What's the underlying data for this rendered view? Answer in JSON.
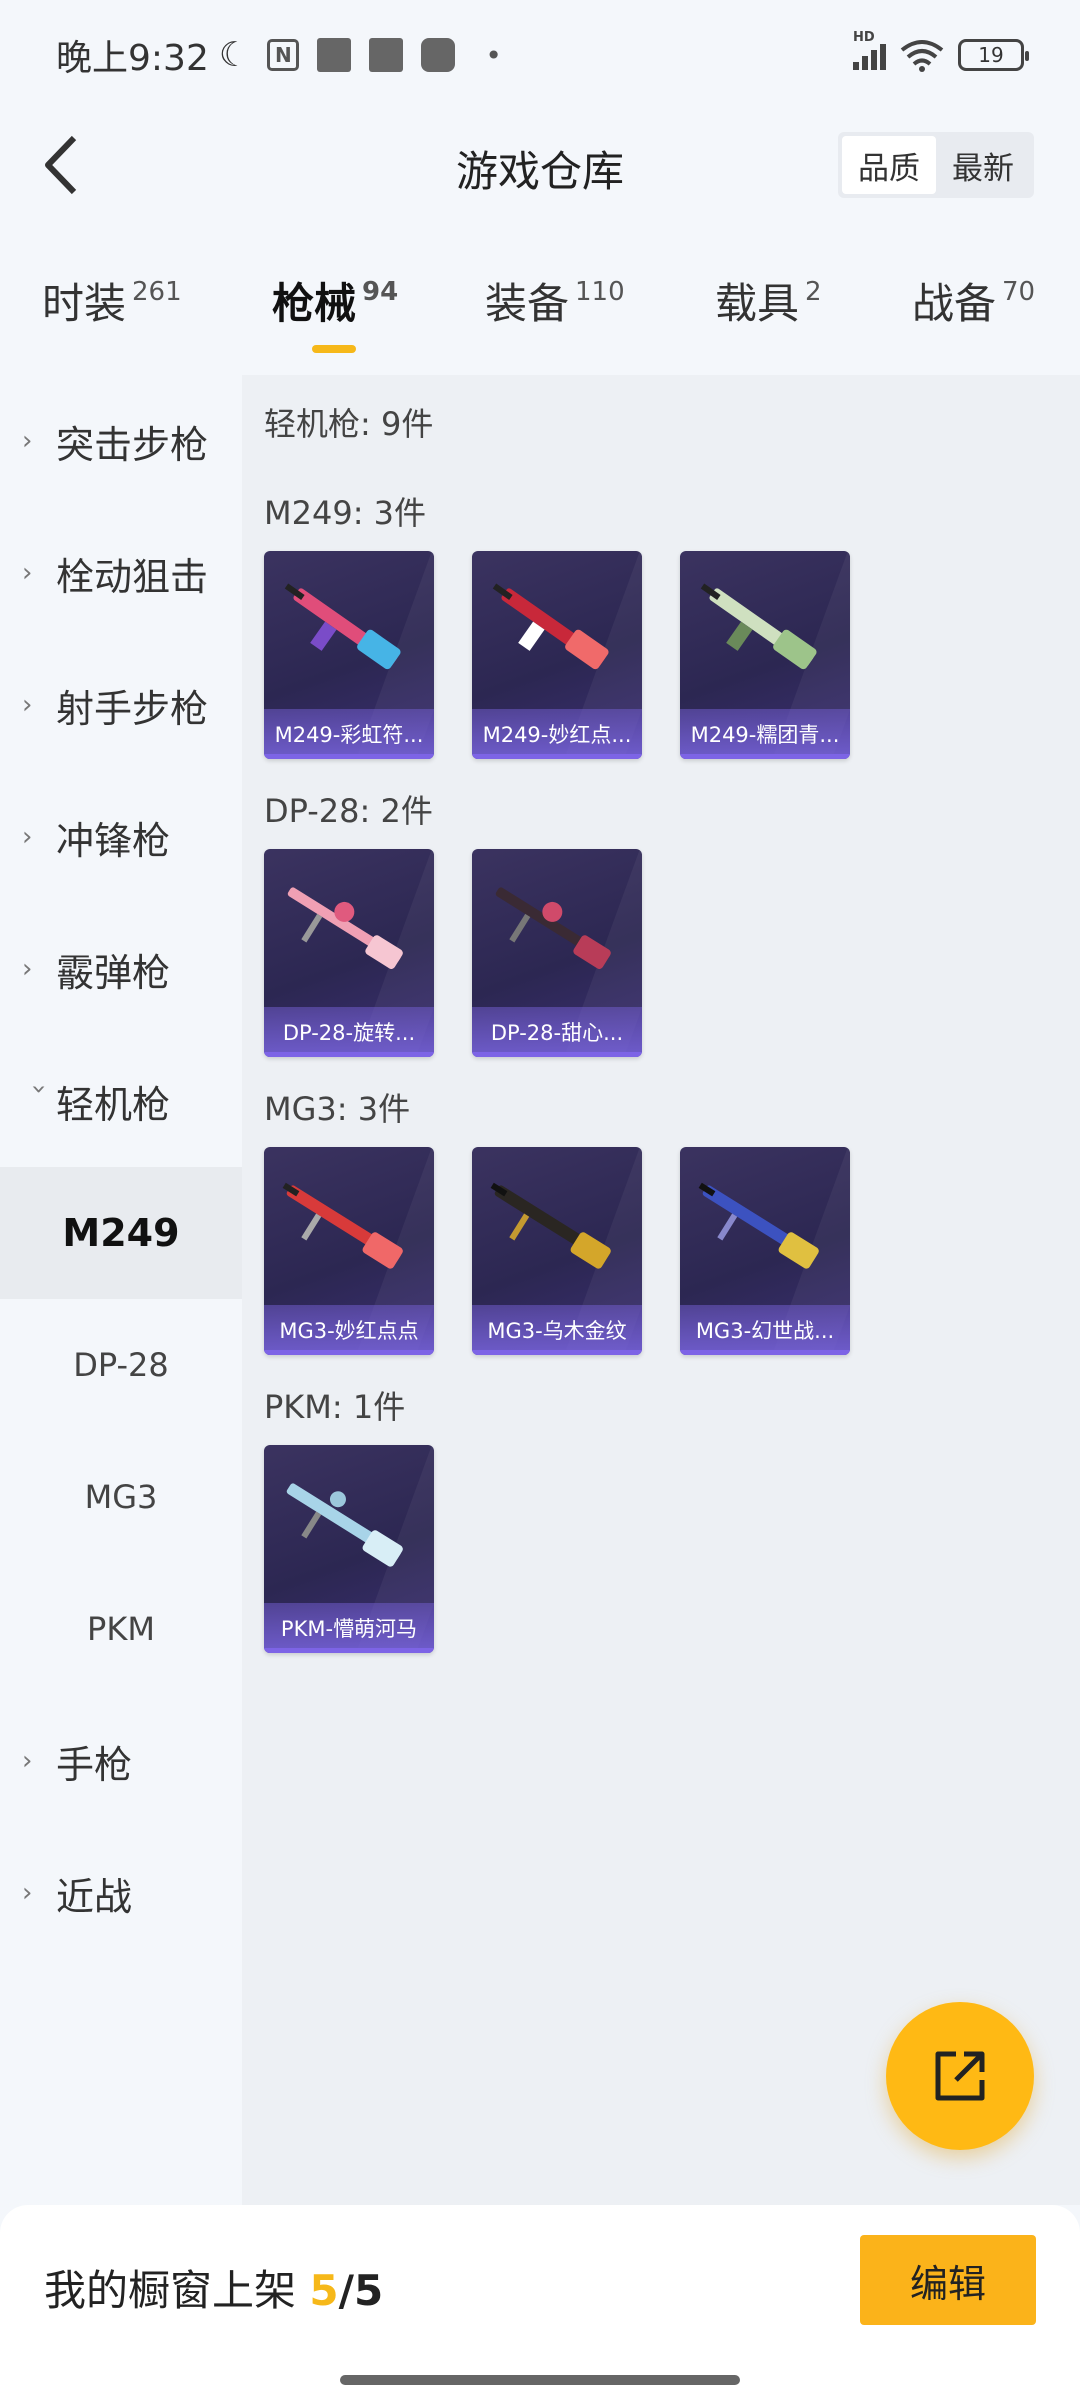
{
  "status_bar": {
    "time": "晚上9:32",
    "nfc": "N",
    "battery": "19",
    "network": "HD"
  },
  "header": {
    "title": "游戏仓库",
    "sort_options": [
      "品质",
      "最新"
    ]
  },
  "tabs": [
    {
      "label": "时装",
      "count": "261"
    },
    {
      "label": "枪械",
      "count": "94"
    },
    {
      "label": "装备",
      "count": "110"
    },
    {
      "label": "载具",
      "count": "2"
    },
    {
      "label": "战备",
      "count": "70"
    }
  ],
  "sidenav": {
    "categories": [
      "突击步枪",
      "栓动狙击",
      "射手步枪",
      "冲锋枪",
      "霰弹枪",
      "轻机枪",
      "手枪",
      "近战"
    ],
    "subitems": [
      "M249",
      "DP-28",
      "MG3",
      "PKM"
    ]
  },
  "content": {
    "summary": "轻机枪: 9件",
    "groups": [
      {
        "title": "M249: 3件",
        "items": [
          "M249-彩虹符...",
          "M249-妙红点...",
          "M249-糯团青..."
        ]
      },
      {
        "title": "DP-28: 2件",
        "items": [
          "DP-28-旋转...",
          "DP-28-甜心..."
        ]
      },
      {
        "title": "MG3: 3件",
        "items": [
          "MG3-妙红点点",
          "MG3-乌木金纹",
          "MG3-幻世战..."
        ]
      },
      {
        "title": "PKM: 1件",
        "items": [
          "PKM-懵萌河马"
        ]
      }
    ]
  },
  "bottom_bar": {
    "label": "我的橱窗上架",
    "count": "5",
    "total": "/5",
    "edit": "编辑"
  },
  "colors": {
    "accent": "#f6b819",
    "card_bg": "#2c2752",
    "card_label": "#7d64e6"
  }
}
